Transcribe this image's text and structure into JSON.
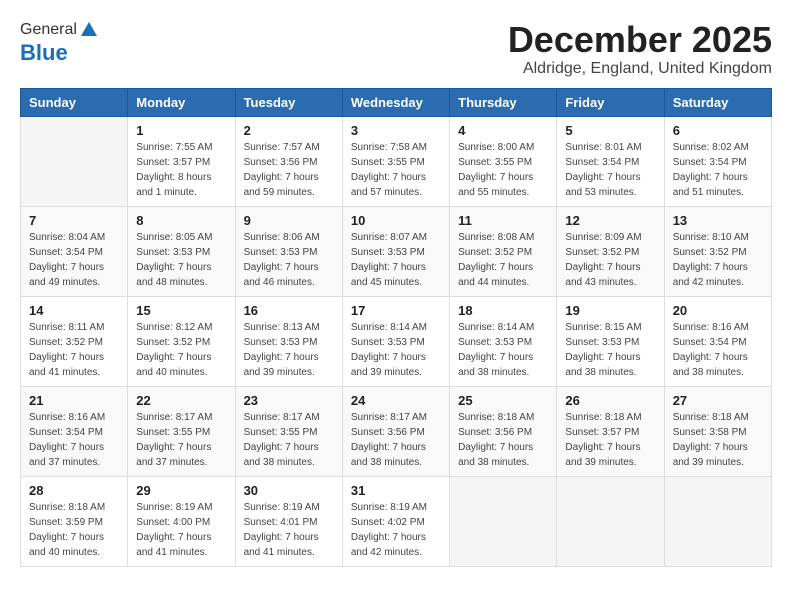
{
  "logo": {
    "general": "General",
    "blue": "Blue"
  },
  "title": "December 2025",
  "subtitle": "Aldridge, England, United Kingdom",
  "days_of_week": [
    "Sunday",
    "Monday",
    "Tuesday",
    "Wednesday",
    "Thursday",
    "Friday",
    "Saturday"
  ],
  "weeks": [
    [
      {
        "day": "",
        "sunrise": "",
        "sunset": "",
        "daylight": ""
      },
      {
        "day": "1",
        "sunrise": "Sunrise: 7:55 AM",
        "sunset": "Sunset: 3:57 PM",
        "daylight": "Daylight: 8 hours and 1 minute."
      },
      {
        "day": "2",
        "sunrise": "Sunrise: 7:57 AM",
        "sunset": "Sunset: 3:56 PM",
        "daylight": "Daylight: 7 hours and 59 minutes."
      },
      {
        "day": "3",
        "sunrise": "Sunrise: 7:58 AM",
        "sunset": "Sunset: 3:55 PM",
        "daylight": "Daylight: 7 hours and 57 minutes."
      },
      {
        "day": "4",
        "sunrise": "Sunrise: 8:00 AM",
        "sunset": "Sunset: 3:55 PM",
        "daylight": "Daylight: 7 hours and 55 minutes."
      },
      {
        "day": "5",
        "sunrise": "Sunrise: 8:01 AM",
        "sunset": "Sunset: 3:54 PM",
        "daylight": "Daylight: 7 hours and 53 minutes."
      },
      {
        "day": "6",
        "sunrise": "Sunrise: 8:02 AM",
        "sunset": "Sunset: 3:54 PM",
        "daylight": "Daylight: 7 hours and 51 minutes."
      }
    ],
    [
      {
        "day": "7",
        "sunrise": "Sunrise: 8:04 AM",
        "sunset": "Sunset: 3:54 PM",
        "daylight": "Daylight: 7 hours and 49 minutes."
      },
      {
        "day": "8",
        "sunrise": "Sunrise: 8:05 AM",
        "sunset": "Sunset: 3:53 PM",
        "daylight": "Daylight: 7 hours and 48 minutes."
      },
      {
        "day": "9",
        "sunrise": "Sunrise: 8:06 AM",
        "sunset": "Sunset: 3:53 PM",
        "daylight": "Daylight: 7 hours and 46 minutes."
      },
      {
        "day": "10",
        "sunrise": "Sunrise: 8:07 AM",
        "sunset": "Sunset: 3:53 PM",
        "daylight": "Daylight: 7 hours and 45 minutes."
      },
      {
        "day": "11",
        "sunrise": "Sunrise: 8:08 AM",
        "sunset": "Sunset: 3:52 PM",
        "daylight": "Daylight: 7 hours and 44 minutes."
      },
      {
        "day": "12",
        "sunrise": "Sunrise: 8:09 AM",
        "sunset": "Sunset: 3:52 PM",
        "daylight": "Daylight: 7 hours and 43 minutes."
      },
      {
        "day": "13",
        "sunrise": "Sunrise: 8:10 AM",
        "sunset": "Sunset: 3:52 PM",
        "daylight": "Daylight: 7 hours and 42 minutes."
      }
    ],
    [
      {
        "day": "14",
        "sunrise": "Sunrise: 8:11 AM",
        "sunset": "Sunset: 3:52 PM",
        "daylight": "Daylight: 7 hours and 41 minutes."
      },
      {
        "day": "15",
        "sunrise": "Sunrise: 8:12 AM",
        "sunset": "Sunset: 3:52 PM",
        "daylight": "Daylight: 7 hours and 40 minutes."
      },
      {
        "day": "16",
        "sunrise": "Sunrise: 8:13 AM",
        "sunset": "Sunset: 3:53 PM",
        "daylight": "Daylight: 7 hours and 39 minutes."
      },
      {
        "day": "17",
        "sunrise": "Sunrise: 8:14 AM",
        "sunset": "Sunset: 3:53 PM",
        "daylight": "Daylight: 7 hours and 39 minutes."
      },
      {
        "day": "18",
        "sunrise": "Sunrise: 8:14 AM",
        "sunset": "Sunset: 3:53 PM",
        "daylight": "Daylight: 7 hours and 38 minutes."
      },
      {
        "day": "19",
        "sunrise": "Sunrise: 8:15 AM",
        "sunset": "Sunset: 3:53 PM",
        "daylight": "Daylight: 7 hours and 38 minutes."
      },
      {
        "day": "20",
        "sunrise": "Sunrise: 8:16 AM",
        "sunset": "Sunset: 3:54 PM",
        "daylight": "Daylight: 7 hours and 38 minutes."
      }
    ],
    [
      {
        "day": "21",
        "sunrise": "Sunrise: 8:16 AM",
        "sunset": "Sunset: 3:54 PM",
        "daylight": "Daylight: 7 hours and 37 minutes."
      },
      {
        "day": "22",
        "sunrise": "Sunrise: 8:17 AM",
        "sunset": "Sunset: 3:55 PM",
        "daylight": "Daylight: 7 hours and 37 minutes."
      },
      {
        "day": "23",
        "sunrise": "Sunrise: 8:17 AM",
        "sunset": "Sunset: 3:55 PM",
        "daylight": "Daylight: 7 hours and 38 minutes."
      },
      {
        "day": "24",
        "sunrise": "Sunrise: 8:17 AM",
        "sunset": "Sunset: 3:56 PM",
        "daylight": "Daylight: 7 hours and 38 minutes."
      },
      {
        "day": "25",
        "sunrise": "Sunrise: 8:18 AM",
        "sunset": "Sunset: 3:56 PM",
        "daylight": "Daylight: 7 hours and 38 minutes."
      },
      {
        "day": "26",
        "sunrise": "Sunrise: 8:18 AM",
        "sunset": "Sunset: 3:57 PM",
        "daylight": "Daylight: 7 hours and 39 minutes."
      },
      {
        "day": "27",
        "sunrise": "Sunrise: 8:18 AM",
        "sunset": "Sunset: 3:58 PM",
        "daylight": "Daylight: 7 hours and 39 minutes."
      }
    ],
    [
      {
        "day": "28",
        "sunrise": "Sunrise: 8:18 AM",
        "sunset": "Sunset: 3:59 PM",
        "daylight": "Daylight: 7 hours and 40 minutes."
      },
      {
        "day": "29",
        "sunrise": "Sunrise: 8:19 AM",
        "sunset": "Sunset: 4:00 PM",
        "daylight": "Daylight: 7 hours and 41 minutes."
      },
      {
        "day": "30",
        "sunrise": "Sunrise: 8:19 AM",
        "sunset": "Sunset: 4:01 PM",
        "daylight": "Daylight: 7 hours and 41 minutes."
      },
      {
        "day": "31",
        "sunrise": "Sunrise: 8:19 AM",
        "sunset": "Sunset: 4:02 PM",
        "daylight": "Daylight: 7 hours and 42 minutes."
      },
      {
        "day": "",
        "sunrise": "",
        "sunset": "",
        "daylight": ""
      },
      {
        "day": "",
        "sunrise": "",
        "sunset": "",
        "daylight": ""
      },
      {
        "day": "",
        "sunrise": "",
        "sunset": "",
        "daylight": ""
      }
    ]
  ]
}
